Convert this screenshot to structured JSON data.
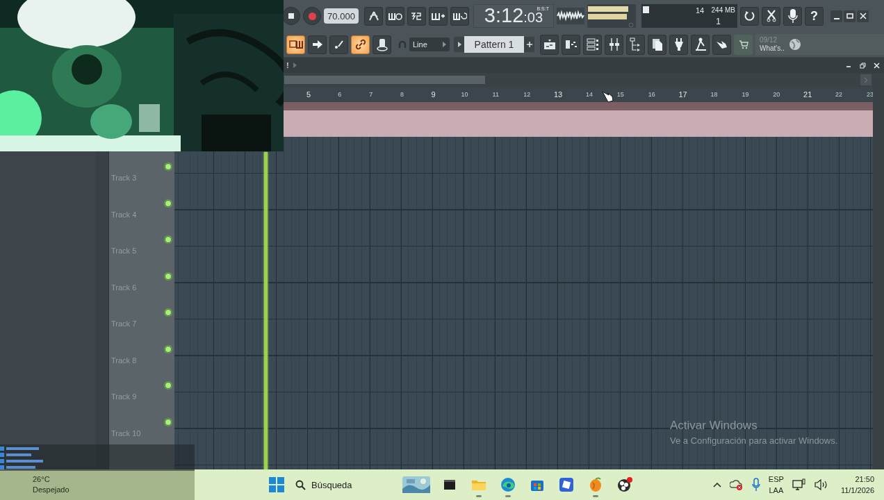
{
  "toolbar": {
    "tempo": "70.000",
    "time": "3:12",
    "time_ticks": ":03",
    "help": "?",
    "time_format": "B:S:T",
    "cpu": "14",
    "memory": "244 MB",
    "polyphony": "1",
    "row1_buttons": [
      {
        "kind": "metronome",
        "on": false
      },
      {
        "kind": "wait",
        "on": false
      },
      {
        "kind": "countdown",
        "on": false
      },
      {
        "kind": "blend",
        "on": false
      },
      {
        "kind": "loop",
        "on": false
      }
    ],
    "row2_buttons": [
      {
        "kind": "typing",
        "on": true
      },
      {
        "kind": "arrow",
        "on": false
      },
      {
        "kind": "step",
        "on": false
      },
      {
        "kind": "link",
        "on": true
      },
      {
        "kind": "knob",
        "on": false
      }
    ],
    "snap": "Line",
    "pattern": "Pattern 1",
    "tools": [
      {
        "kind": "playlist"
      },
      {
        "kind": "pianoroll"
      },
      {
        "kind": "channels"
      },
      {
        "kind": "mixer"
      },
      {
        "kind": "browser"
      },
      {
        "kind": "files"
      },
      {
        "kind": "plugin"
      },
      {
        "kind": "pedal"
      },
      {
        "kind": "hand"
      },
      {
        "kind": "cart"
      }
    ],
    "news_date": "09/12",
    "news_title": "What's.."
  },
  "playlist": {
    "title_mark": "!",
    "ruler": [
      {
        "label": "5",
        "major": true
      },
      {
        "label": "6",
        "major": false
      },
      {
        "label": "7",
        "major": false
      },
      {
        "label": "8",
        "major": false
      },
      {
        "label": "9",
        "major": true
      },
      {
        "label": "10",
        "major": false
      },
      {
        "label": "11",
        "major": false
      },
      {
        "label": "12",
        "major": false
      },
      {
        "label": "13",
        "major": true
      },
      {
        "label": "14",
        "major": false
      },
      {
        "label": "15",
        "major": false
      },
      {
        "label": "16",
        "major": false
      },
      {
        "label": "17",
        "major": true
      },
      {
        "label": "18",
        "major": false
      },
      {
        "label": "19",
        "major": false
      },
      {
        "label": "20",
        "major": false
      },
      {
        "label": "21",
        "major": true
      },
      {
        "label": "22",
        "major": false
      },
      {
        "label": "23",
        "major": false
      }
    ],
    "tracks": [
      {
        "name": "Track 3"
      },
      {
        "name": "Track 4"
      },
      {
        "name": "Track 5"
      },
      {
        "name": "Track 6"
      },
      {
        "name": "Track 7"
      },
      {
        "name": "Track 8"
      },
      {
        "name": "Track 9"
      },
      {
        "name": "Track 10"
      }
    ]
  },
  "watermark": {
    "title": "Activar Windows",
    "text": "Ve a Configuración para activar Windows."
  },
  "taskbar": {
    "weather_temp": "26°C",
    "weather_text": "Despejado",
    "search_placeholder": "Búsqueda",
    "apps": [
      {
        "kind": "picture",
        "running": false
      },
      {
        "kind": "terminal",
        "running": false
      },
      {
        "kind": "folder",
        "running": true
      },
      {
        "kind": "edge",
        "running": true
      },
      {
        "kind": "store",
        "running": false
      },
      {
        "kind": "roblox",
        "running": false
      },
      {
        "kind": "fruit",
        "running": true
      },
      {
        "kind": "obs",
        "running": false
      }
    ],
    "lang": "ESP",
    "layout": "LAA",
    "time": "21:50",
    "date": "11/1/2026"
  }
}
